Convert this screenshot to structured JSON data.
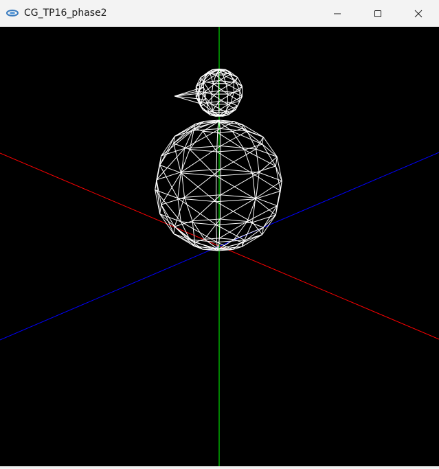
{
  "window": {
    "title": "CG_TP16_phase2",
    "icon": "app-icon"
  },
  "controls": {
    "minimize": "minimize-icon",
    "maximize": "maximize-icon",
    "close": "close-icon"
  },
  "colors": {
    "titlebar": "#f3f3f3",
    "viewport_background": "#000000",
    "x_axis": "#ff0000",
    "y_axis": "#00ff00",
    "z_axis": "#0000ff",
    "wireframe": "#ffffff"
  },
  "scene": {
    "objects": [
      "body-sphere",
      "head-sphere",
      "beak-cone"
    ],
    "axes": [
      "x-axis",
      "y-axis",
      "z-axis"
    ],
    "render_mode": "wireframe"
  }
}
